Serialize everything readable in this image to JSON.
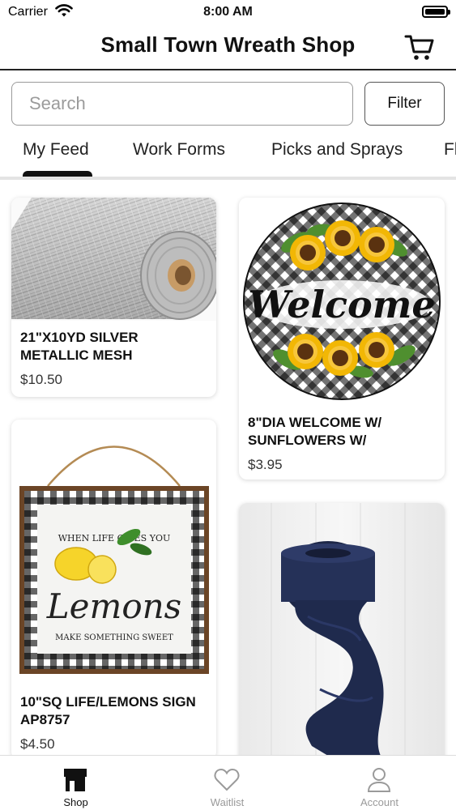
{
  "status_bar": {
    "carrier": "Carrier",
    "time": "8:00 AM"
  },
  "header": {
    "title": "Small Town Wreath Shop"
  },
  "search": {
    "placeholder": "Search",
    "value": ""
  },
  "filter": {
    "label": "Filter"
  },
  "tabs": [
    {
      "label": "My Feed",
      "active": true
    },
    {
      "label": "Work Forms",
      "active": false
    },
    {
      "label": "Picks and Sprays",
      "active": false
    },
    {
      "label": "Fl",
      "active": false
    }
  ],
  "products": [
    {
      "title": "21\"X10YD SILVER METALLIC MESH",
      "price": "$10.50"
    },
    {
      "title": "8\"DIA WELCOME W/ SUNFLOWERS W/",
      "price": "$3.95"
    },
    {
      "title": "10\"SQ LIFE/LEMONS SIGN AP8757",
      "price": "$4.50"
    },
    {
      "title": "",
      "price": ""
    }
  ],
  "product_images": {
    "welcome_sign_text": "Welcome",
    "lemon_sign_arc_text": "WHEN LIFE GIVES YOU",
    "lemon_sign_main_text": "Lemons",
    "lemon_sign_bottom_text": "MAKE SOMETHING SWEET"
  },
  "tabbar": [
    {
      "label": "Shop",
      "icon": "storefront-icon",
      "active": true
    },
    {
      "label": "Waitlist",
      "icon": "heart-icon",
      "active": false
    },
    {
      "label": "Account",
      "icon": "person-icon",
      "active": false
    }
  ],
  "colors": {
    "accent": "#111111",
    "inactive": "#9a9a9a",
    "card_shadow": "#d9d9d9"
  }
}
